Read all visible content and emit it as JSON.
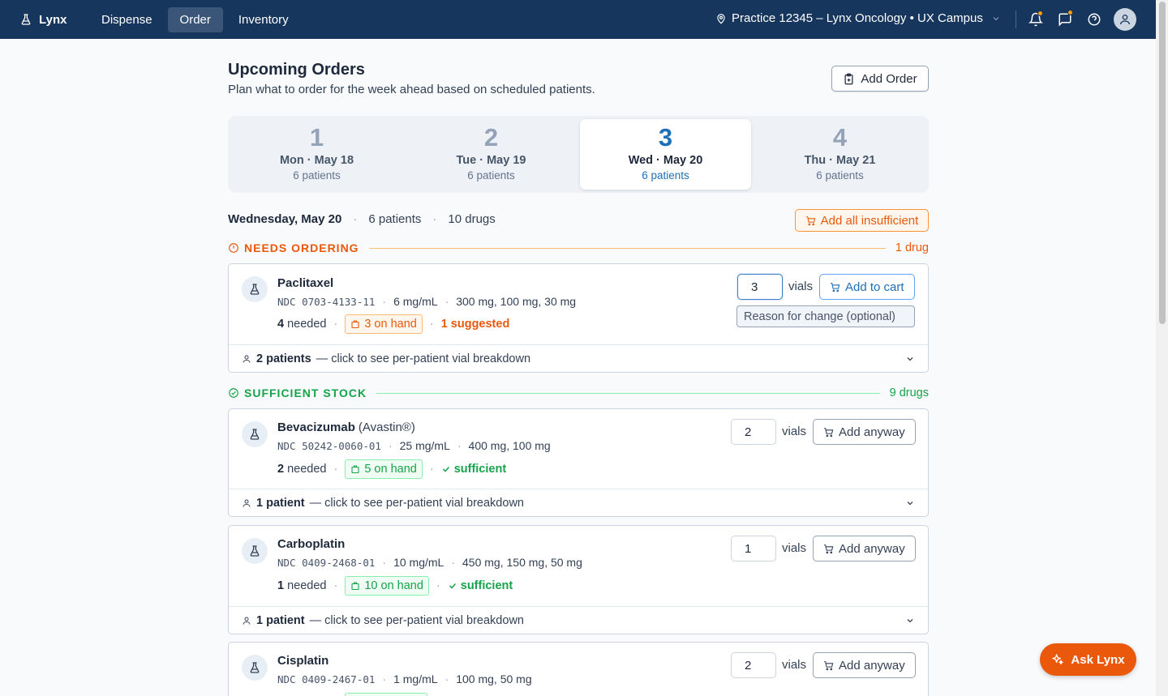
{
  "app": {
    "name": "Lynx"
  },
  "nav": [
    {
      "label": "Dispense",
      "active": false
    },
    {
      "label": "Order",
      "active": true
    },
    {
      "label": "Inventory",
      "active": false
    }
  ],
  "practice": {
    "label": "Practice 12345 – Lynx Oncology • UX Campus"
  },
  "header": {
    "title": "Upcoming Orders",
    "subtitle": "Plan what to order for the week ahead based on scheduled patients.",
    "add_order_label": "Add Order"
  },
  "days": [
    {
      "num": "1",
      "label": "Mon · May 18",
      "patients": "6 patients",
      "active": false
    },
    {
      "num": "2",
      "label": "Tue · May 19",
      "patients": "6 patients",
      "active": false
    },
    {
      "num": "3",
      "label": "Wed · May 20",
      "patients": "6 patients",
      "active": true
    },
    {
      "num": "4",
      "label": "Thu · May 21",
      "patients": "6 patients",
      "active": false
    }
  ],
  "summary": {
    "date": "Wednesday, May 20",
    "patients": "6 patients",
    "drugs": "10 drugs",
    "add_all_label": "Add all insufficient"
  },
  "sections": {
    "needs": {
      "title": "NEEDS ORDERING",
      "count": "1 drug"
    },
    "sufficient": {
      "title": "SUFFICIENT STOCK",
      "count": "9 drugs"
    }
  },
  "drugs": [
    {
      "name": "Paclitaxel",
      "brand": "",
      "ndc": "NDC 0703-4133-11",
      "concentration": "6 mg/mL",
      "sizes": "300 mg, 100 mg, 30 mg",
      "needed_num": "4",
      "needed_label": "needed",
      "on_hand": "3 on hand",
      "status": "1 suggested",
      "qty": "3",
      "unit": "vials",
      "action": "Add to cart",
      "reason_placeholder": "Reason for change (optional)",
      "patients_num": "2 patients",
      "patients_text": "— click to see per-patient vial breakdown"
    },
    {
      "name": "Bevacizumab",
      "brand": "(Avastin®)",
      "ndc": "NDC 50242-0060-01",
      "concentration": "25 mg/mL",
      "sizes": "400 mg, 100 mg",
      "needed_num": "2",
      "needed_label": "needed",
      "on_hand": "5 on hand",
      "status": "sufficient",
      "qty": "2",
      "unit": "vials",
      "action": "Add anyway",
      "patients_num": "1 patient",
      "patients_text": "— click to see per-patient vial breakdown"
    },
    {
      "name": "Carboplatin",
      "brand": "",
      "ndc": "NDC 0409-2468-01",
      "concentration": "10 mg/mL",
      "sizes": "450 mg, 150 mg, 50 mg",
      "needed_num": "1",
      "needed_label": "needed",
      "on_hand": "10 on hand",
      "status": "sufficient",
      "qty": "1",
      "unit": "vials",
      "action": "Add anyway",
      "patients_num": "1 patient",
      "patients_text": "— click to see per-patient vial breakdown"
    },
    {
      "name": "Cisplatin",
      "brand": "",
      "ndc": "NDC 0409-2467-01",
      "concentration": "1 mg/mL",
      "sizes": "100 mg, 50 mg",
      "qty": "2",
      "unit": "vials",
      "action": "Add anyway"
    }
  ],
  "ask_label": "Ask Lynx",
  "icons": {
    "brand": "flask-icon",
    "location": "map-pin-icon",
    "notifications": "bell-icon",
    "messages": "message-square-icon",
    "help": "help-circle-icon",
    "account": "user-icon",
    "cart": "shopping-cart-icon",
    "clipboard": "clipboard-plus-icon",
    "ask": "sparkles-icon"
  },
  "colors": {
    "nav_bg": "#17365d",
    "accent": "#1d6fb8",
    "warning": "#ea580c",
    "success": "#16a34a"
  }
}
